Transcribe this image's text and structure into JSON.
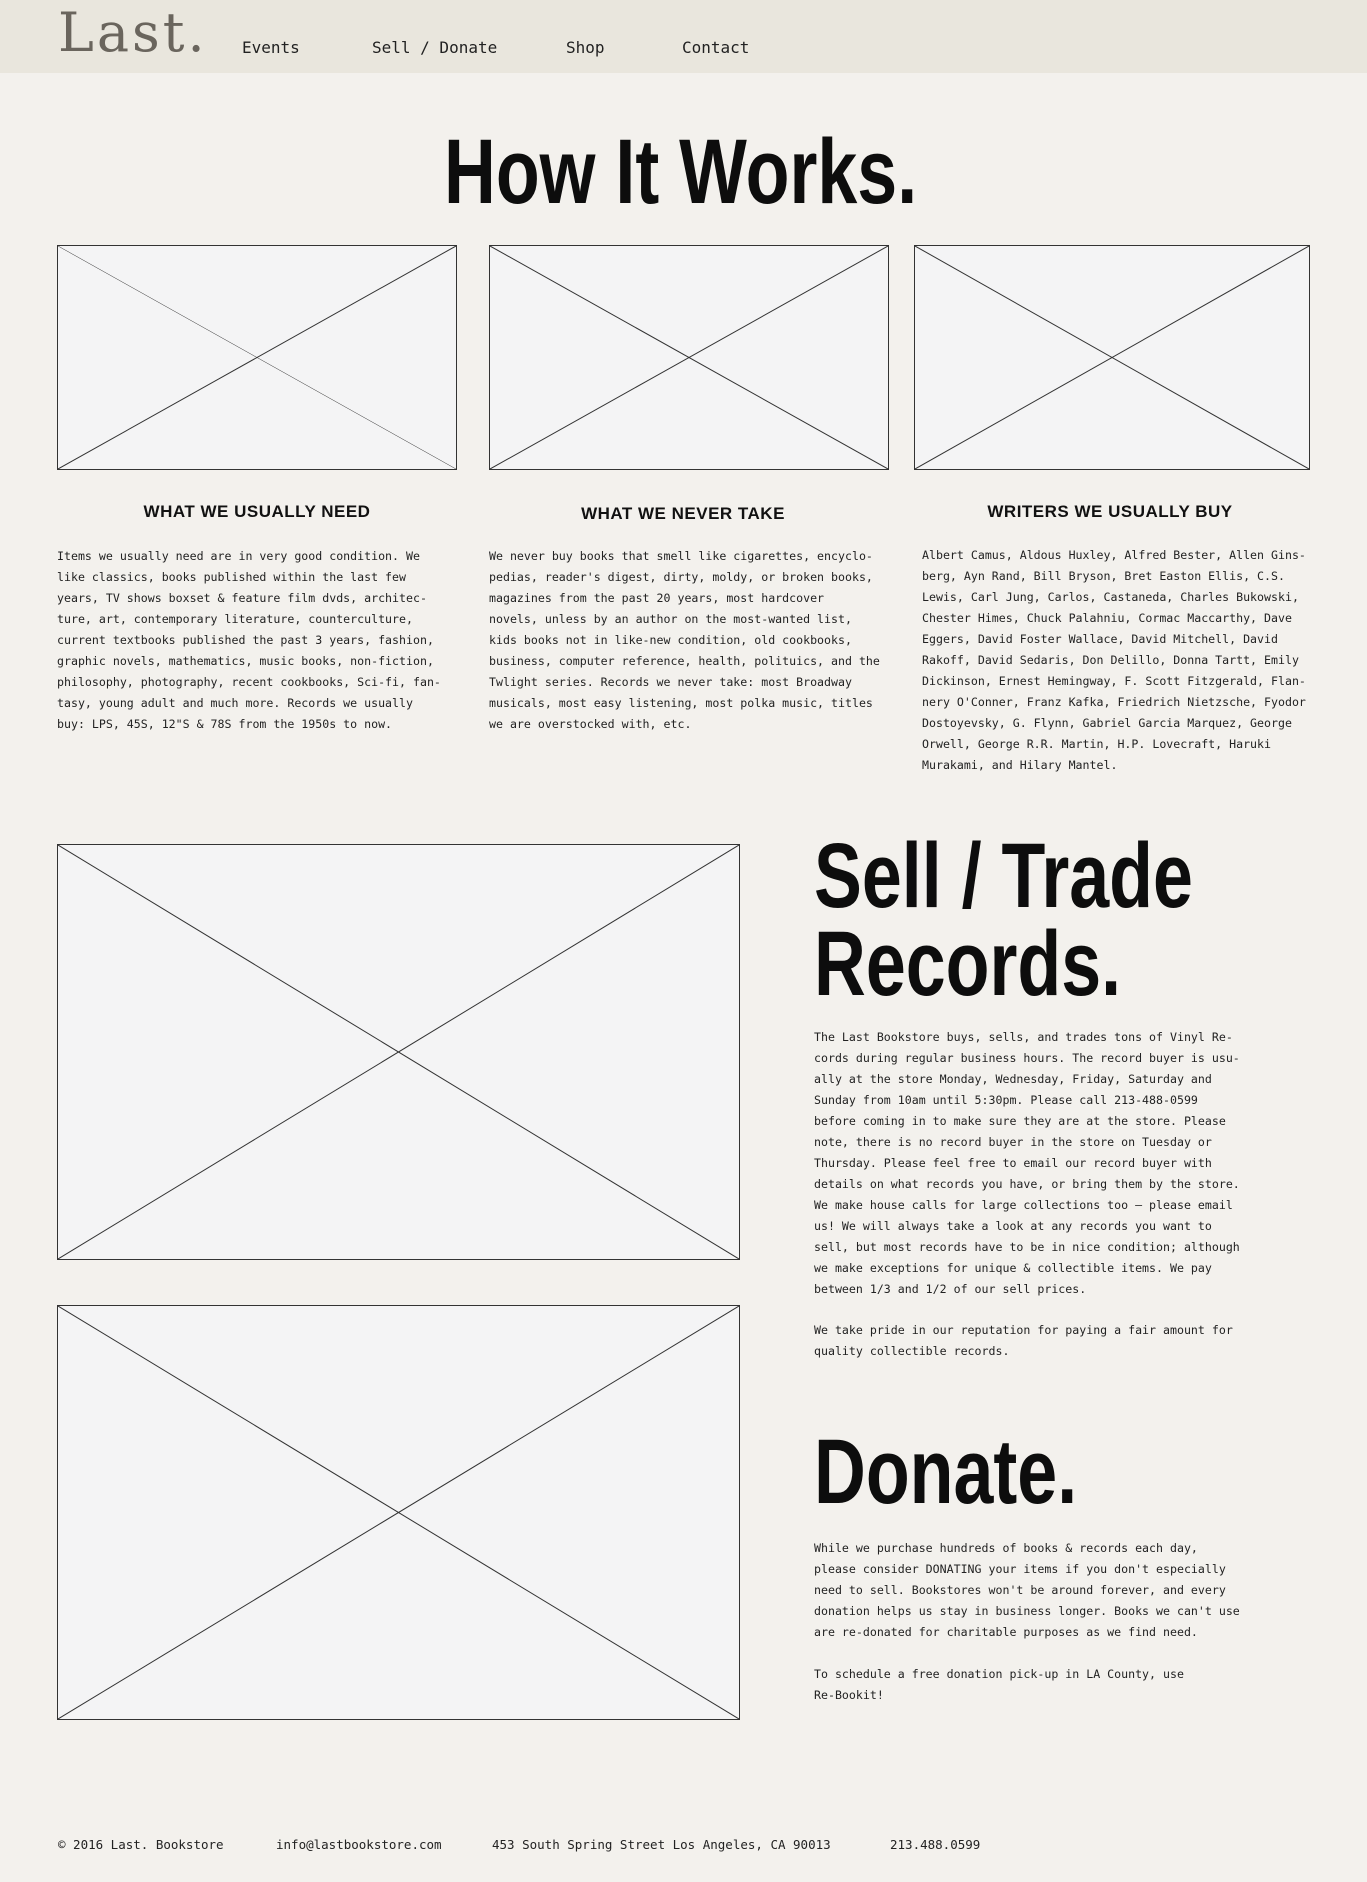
{
  "header": {
    "logo_text": "Last.",
    "nav": [
      "Events",
      "Sell / Donate",
      "Shop",
      "Contact"
    ]
  },
  "how_it_works": {
    "title": "How It Works.",
    "columns": [
      {
        "heading": "WHAT WE USUALLY NEED",
        "text": "Items we usually need are in very good condition. We\nlike classics, books published within the last few\nyears, TV shows boxset & feature film dvds, architec-\nture, art, contemporary literature, counterculture,\ncurrent textbooks published the past 3 years, fashion,\ngraphic novels, mathematics, music books, non-fiction,\nphilosophy, photography, recent cookbooks, Sci-fi, fan-\ntasy, young adult and much more. Records we usually\nbuy: LPS, 45S, 12\"S & 78S from the 1950s to now."
      },
      {
        "heading": "WHAT WE NEVER TAKE",
        "text": "We never buy books that smell like cigarettes, encyclo-\npedias, reader's digest, dirty, moldy, or broken books,\nmagazines from the past 20 years, most hardcover\nnovels, unless by an author on the most-wanted list,\nkids books not in like-new condition, old cookbooks,\nbusiness, computer reference, health, polituics, and the\nTwlight series. Records we never take: most Broadway\nmusicals, most easy listening, most polka music, titles\nwe are overstocked with, etc."
      },
      {
        "heading": "WRITERS WE USUALLY BUY",
        "text": "Albert Camus, Aldous Huxley, Alfred Bester, Allen Gins-\nberg, Ayn Rand, Bill Bryson, Bret Easton Ellis, C.S.\nLewis, Carl Jung, Carlos, Castaneda, Charles Bukowski,\nChester Himes, Chuck Palahniu, Cormac Maccarthy, Dave\nEggers, David Foster Wallace, David Mitchell, David\nRakoff, David Sedaris, Don Delillo, Donna Tartt, Emily\nDickinson, Ernest Hemingway, F. Scott Fitzgerald, Flan-\nnery O'Conner, Franz Kafka, Friedrich Nietzsche, Fyodor\nDostoyevsky, G. Flynn, Gabriel Garcia Marquez, George\nOrwell, George R.R. Martin, H.P. Lovecraft, Haruki\nMurakami, and Hilary Mantel."
      }
    ]
  },
  "sell_trade": {
    "title_line1": "Sell / Trade",
    "title_line2": "Records.",
    "paragraph1": "The Last Bookstore buys, sells, and trades tons of Vinyl Re-\ncords during regular business hours. The record buyer is usu-\nally at the store Monday, Wednesday, Friday, Saturday and\nSunday from 10am until 5:30pm. Please call 213-488-0599\nbefore coming in to make sure they are at the store.  Please\nnote, there is no record buyer in the store on Tuesday or\nThursday. Please feel free to email our record buyer with\ndetails on what records you have, or bring them by the store.\nWe make house calls for large collections too – please email\nus! We will always take a look at any records you want to\nsell, but most records have to be in nice condition; although\nwe make exceptions for unique & collectible items. We pay\nbetween 1/3 and 1/2 of our sell prices.",
    "paragraph2": "We take pride in our reputation for paying a fair amount for\nquality collectible records."
  },
  "donate": {
    "title": "Donate.",
    "paragraph1": "While we purchase hundreds of books & records each day,\nplease consider DONATING your items if you don't especially\nneed to sell. Bookstores won't be around forever, and every\ndonation helps us stay in business longer. Books we can't use\nare re-donated for charitable purposes as we find need.",
    "paragraph2": "To schedule a free donation pick-up in LA County, use\nRe-Bookit!"
  },
  "footer": {
    "copyright": "© 2016 Last. Bookstore",
    "email": "info@lastbookstore.com",
    "address": "453 South Spring Street Los Angeles, CA 90013",
    "phone": "213.488.0599"
  }
}
